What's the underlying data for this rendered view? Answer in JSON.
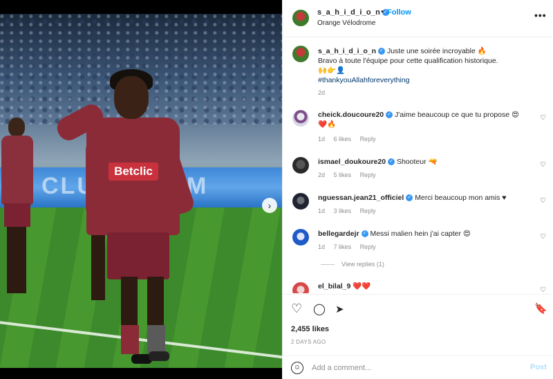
{
  "post": {
    "author": "s_a_h_i_d_i_o_n",
    "follow_label": "Follow",
    "separator": "•",
    "location": "Orange Vélodrome",
    "more_label": "•••",
    "photo": {
      "board_text": "CLUB · L'OM",
      "sponsor": "Betclic"
    },
    "next_label": "›"
  },
  "caption": {
    "author": "s_a_h_i_d_i_o_n",
    "line1": "Juste une soirée incroyable 🔥",
    "line2": "Bravo à toute l'équipe pour cette qualification historique.",
    "line3": "🙌👉👤",
    "hashtag": "#thankyouAllahforeverything",
    "time": "2d"
  },
  "comments": [
    {
      "user": "cheick.doucoure20",
      "text": "J'aime beaucoup ce que tu propose 😍",
      "text2": "❤️🔥",
      "time": "1d",
      "likes": "6 likes",
      "reply": "Reply"
    },
    {
      "user": "ismael_doukoure20",
      "text": "Shooteur 🔫",
      "time": "2d",
      "likes": "5 likes",
      "reply": "Reply"
    },
    {
      "user": "nguessan.jean21_officiel",
      "text": "Merci beaucoup mon amis ♥",
      "time": "1d",
      "likes": "3 likes",
      "reply": "Reply"
    },
    {
      "user": "bellegardejr",
      "text": "Messi malien hein j'ai capter 😍",
      "time": "1d",
      "likes": "7 likes",
      "reply": "Reply"
    },
    {
      "user": "el_bilal_9",
      "text": "❤️❤️"
    }
  ],
  "view_replies": "View replies (1)",
  "actions": {
    "likes": "2,455 likes",
    "date": "2 DAYS AGO"
  },
  "add_comment": {
    "placeholder": "Add a comment...",
    "emoji": "☺",
    "post_label": "Post"
  },
  "icons": {
    "heart": "♡",
    "comment": "◯",
    "share": "➤",
    "save": "🔖"
  },
  "colors": {
    "accent": "#0095f6",
    "verified": "#3897f0",
    "shirt": "#8c2b38"
  }
}
